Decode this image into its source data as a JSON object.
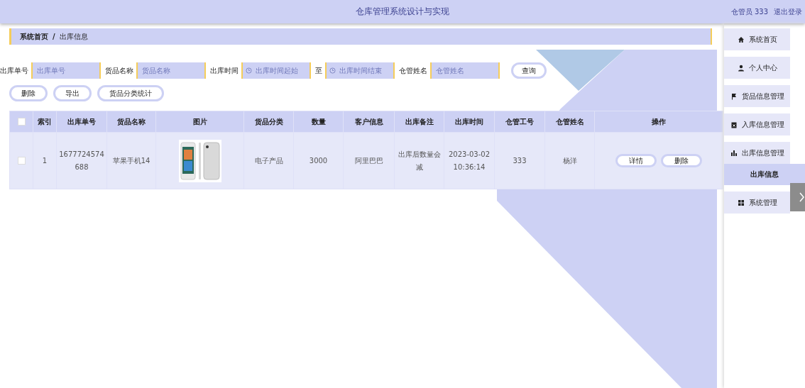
{
  "header": {
    "title": "仓库管理系统设计与实现",
    "user": "仓管员 333",
    "logout": "退出登录"
  },
  "breadcrumb": [
    "系统首页",
    "出库信息"
  ],
  "breadcrumb_separator": "/",
  "filters": [
    {
      "label": "出库单号",
      "placeholder": "出库单号",
      "kind": "text"
    },
    {
      "label": "货品名称",
      "placeholder": "货品名称",
      "kind": "text"
    },
    {
      "label": "出库时间",
      "placeholder": "出库时间起始",
      "kind": "date"
    },
    {
      "label": "至",
      "placeholder": "出库时间结束",
      "kind": "date"
    },
    {
      "label": "仓管姓名",
      "placeholder": "仓管姓名",
      "kind": "text"
    }
  ],
  "search_button": "查询",
  "actions": [
    "删除",
    "导出",
    "货品分类统计"
  ],
  "table": {
    "columns": [
      "索引",
      "出库单号",
      "货品名称",
      "图片",
      "货品分类",
      "数量",
      "客户信息",
      "出库备注",
      "出库时间",
      "仓管工号",
      "仓管姓名",
      "操作"
    ],
    "header_checked": false,
    "rows": [
      {
        "checked": false,
        "cells": [
          "1",
          "1677724574688",
          "苹果手机14",
          null,
          "电子产品",
          "3000",
          "阿里巴巴",
          "出库后数量会减",
          "2023-03-02 10:36:14",
          "333",
          "杨洋"
        ],
        "buttons": [
          "详情",
          "删除"
        ]
      }
    ]
  },
  "sidebar": {
    "items": [
      {
        "label": "系统首页",
        "selected": false
      },
      {
        "label": "个人中心",
        "selected": false
      },
      {
        "label": "货品信息管理",
        "selected": false
      },
      {
        "label": "入库信息管理",
        "selected": false
      },
      {
        "label": "出库信息管理",
        "selected": false,
        "children": [
          {
            "label": "出库信息",
            "selected": true
          }
        ]
      },
      {
        "label": "系统管理",
        "selected": false
      }
    ]
  }
}
